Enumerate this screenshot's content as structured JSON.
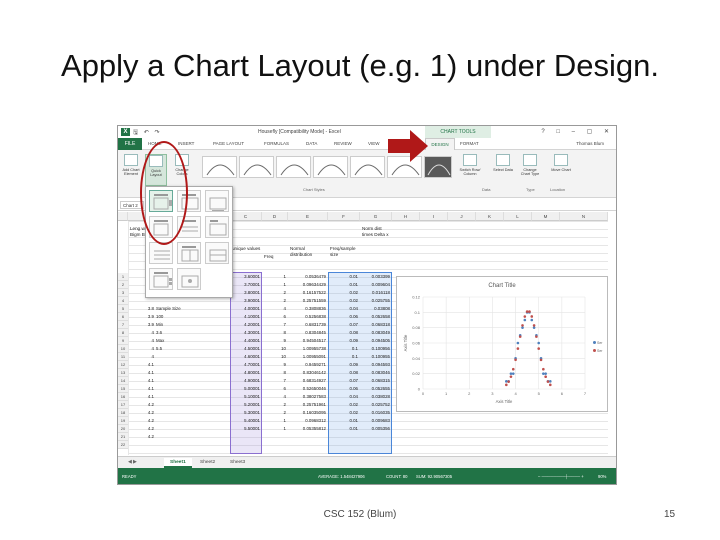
{
  "slide": {
    "title": "Apply a Chart Layout (e.g. 1) under Design.",
    "footer": "CSC 152 (Blum)",
    "page_number": "15"
  },
  "excel": {
    "window_title": "Housefly  [Compatibility Mode] - Excel",
    "chart_tools_label": "CHART TOOLS",
    "tabs": [
      "FILE",
      "HOME",
      "INSERT",
      "PAGE LAYOUT",
      "FORMULAS",
      "DATA",
      "REVIEW",
      "VIEW",
      "DESIGN",
      "FORMAT"
    ],
    "user": "Thomas Blum",
    "ribbon": {
      "add_chart_element": "Add Chart Element",
      "quick_layout": "Quick Layout",
      "change_colors": "Change Colors",
      "chart_styles_label": "Chart Styles",
      "switch_row_column": "Switch Row/ Column",
      "select_data": "Select Data",
      "change_chart_type": "Change Chart Type",
      "move_chart": "Move Chart",
      "data_label": "Data",
      "type_label": "Type",
      "location_label": "Location"
    },
    "name_box": "Chart 2",
    "columns": [
      "C",
      "D",
      "E",
      "F",
      "G",
      "H",
      "I",
      "J",
      "K",
      "L",
      "M",
      "N"
    ],
    "headers": {
      "a": "Leng wing Bigm Bot",
      "c": "unique values",
      "d": "Freq",
      "e": "Normal distribution",
      "f": "Freq/sample size",
      "g": "Norm dist times Delta x"
    },
    "rows": [
      {
        "n": "1",
        "a": "",
        "b": "",
        "c": "3.60001",
        "d": "1",
        "e": "0.0536479",
        "f": "0.01",
        "g": "0.003399"
      },
      {
        "n": "2",
        "a": "",
        "b": "",
        "c": "3.70001",
        "d": "1",
        "e": "0.09634429",
        "f": "0.01",
        "g": "0.009604"
      },
      {
        "n": "3",
        "a": "",
        "b": "",
        "c": "3.80001",
        "d": "2",
        "e": "0.16157522",
        "f": "0.02",
        "g": "0.016118"
      },
      {
        "n": "4",
        "a": "",
        "b": "",
        "c": "3.90001",
        "d": "2",
        "e": "0.25751559",
        "f": "0.02",
        "g": "0.025755"
      },
      {
        "n": "5",
        "a": "3.8",
        "b": "Sample Size",
        "c": "4.00001",
        "d": "4",
        "e": "0.3808836",
        "f": "0.04",
        "g": "0.03808"
      },
      {
        "n": "6",
        "a": "3.9",
        "b": "100",
        "c": "4.10001",
        "d": "6",
        "e": "0.5256838",
        "f": "0.06",
        "g": "0.052658"
      },
      {
        "n": "7",
        "a": "3.9",
        "b": "Min",
        "c": "4.20001",
        "d": "7",
        "e": "0.6831739",
        "f": "0.07",
        "g": "0.068318"
      },
      {
        "n": "8",
        "a": "4",
        "b": "3.6",
        "c": "4.30001",
        "d": "8",
        "e": "0.8304845",
        "f": "0.08",
        "g": "0.083049"
      },
      {
        "n": "9",
        "a": "4",
        "b": "Max",
        "c": "4.40001",
        "d": "9",
        "e": "0.94504517",
        "f": "0.09",
        "g": "0.094505"
      },
      {
        "n": "10",
        "a": "4",
        "b": "5.5",
        "c": "4.50001",
        "d": "10",
        "e": "1.00955738",
        "f": "0.1",
        "g": "0.100956"
      },
      {
        "n": "11",
        "a": "4",
        "b": "",
        "c": "4.60001",
        "d": "10",
        "e": "1.00955091",
        "f": "0.1",
        "g": "0.100955"
      },
      {
        "n": "12",
        "a": "4.1",
        "b": "",
        "c": "4.70001",
        "d": "9",
        "e": "0.9459271",
        "f": "0.09",
        "g": "0.094593"
      },
      {
        "n": "13",
        "a": "4.1",
        "b": "",
        "c": "4.80001",
        "d": "8",
        "e": "0.83046142",
        "f": "0.08",
        "g": "0.083046"
      },
      {
        "n": "14",
        "a": "4.1",
        "b": "",
        "c": "4.90001",
        "d": "7",
        "e": "0.68314927",
        "f": "0.07",
        "g": "0.068315"
      },
      {
        "n": "15",
        "a": "4.1",
        "b": "",
        "c": "5.00001",
        "d": "6",
        "e": "0.52650046",
        "f": "0.06",
        "g": "0.052655"
      },
      {
        "n": "16",
        "a": "4.1",
        "b": "",
        "c": "5.10001",
        "d": "4",
        "e": "0.38027583",
        "f": "0.04",
        "g": "0.038028"
      },
      {
        "n": "17",
        "a": "4.2",
        "b": "",
        "c": "5.20001",
        "d": "2",
        "e": "0.25751961",
        "f": "0.02",
        "g": "0.025752"
      },
      {
        "n": "18",
        "a": "4.2",
        "b": "",
        "c": "5.30001",
        "d": "2",
        "e": "0.16035095",
        "f": "0.02",
        "g": "0.016035"
      },
      {
        "n": "19",
        "a": "4.2",
        "b": "",
        "c": "5.40001",
        "d": "1",
        "e": "0.0968312",
        "f": "0.01",
        "g": "0.009683"
      },
      {
        "n": "20",
        "a": "4.2",
        "b": "",
        "c": "5.50001",
        "d": "1",
        "e": "0.05355812",
        "f": "0.01",
        "g": "0.005356"
      },
      {
        "n": "21",
        "a": "4.2",
        "b": "",
        "c": "",
        "d": "",
        "e": "",
        "f": "",
        "g": ""
      },
      {
        "n": "22",
        "a": "",
        "b": "",
        "c": "",
        "d": "",
        "e": "",
        "f": "",
        "g": ""
      }
    ],
    "sheets": [
      "Sheet1",
      "Sheet2",
      "Sheet3"
    ],
    "status": {
      "ready": "READY",
      "average": "AVERAGE: 1.548427906",
      "count": "COUNT: 80",
      "sum": "SUM: 92.90567305",
      "zoom": "90%"
    },
    "colors": {
      "excel_green": "#217346",
      "annotation_red": "#b01818",
      "series1": "#4f81bd",
      "series2": "#c0504d"
    }
  },
  "chart_data": {
    "type": "scatter",
    "title": "Chart Title",
    "xlabel": "Axis Title",
    "ylabel": "Axis Title",
    "xlim": [
      0,
      7
    ],
    "ylim": [
      0,
      0.12
    ],
    "x_ticks": [
      "0",
      "1",
      "2",
      "3",
      "4",
      "5",
      "6",
      "7"
    ],
    "y_ticks": [
      "0",
      "0.02",
      "0.04",
      "0.06",
      "0.08",
      "0.1",
      "0.12"
    ],
    "series": [
      {
        "name": "Ser",
        "x": [
          3.6,
          3.7,
          3.8,
          3.9,
          4.0,
          4.1,
          4.2,
          4.3,
          4.4,
          4.5,
          4.6,
          4.7,
          4.8,
          4.9,
          5.0,
          5.1,
          5.2,
          5.3,
          5.4,
          5.5
        ],
        "values": [
          0.01,
          0.01,
          0.02,
          0.02,
          0.04,
          0.06,
          0.07,
          0.08,
          0.09,
          0.1,
          0.1,
          0.09,
          0.08,
          0.07,
          0.06,
          0.04,
          0.02,
          0.02,
          0.01,
          0.01
        ]
      },
      {
        "name": "Ser",
        "x": [
          3.6,
          3.7,
          3.8,
          3.9,
          4.0,
          4.1,
          4.2,
          4.3,
          4.4,
          4.5,
          4.6,
          4.7,
          4.8,
          4.9,
          5.0,
          5.1,
          5.2,
          5.3,
          5.4,
          5.5
        ],
        "values": [
          0.0054,
          0.0096,
          0.0161,
          0.0258,
          0.0381,
          0.0527,
          0.0683,
          0.083,
          0.0945,
          0.101,
          0.101,
          0.0946,
          0.083,
          0.0683,
          0.0527,
          0.038,
          0.0258,
          0.016,
          0.0097,
          0.0054
        ]
      }
    ],
    "grid": true,
    "legend": "right"
  }
}
